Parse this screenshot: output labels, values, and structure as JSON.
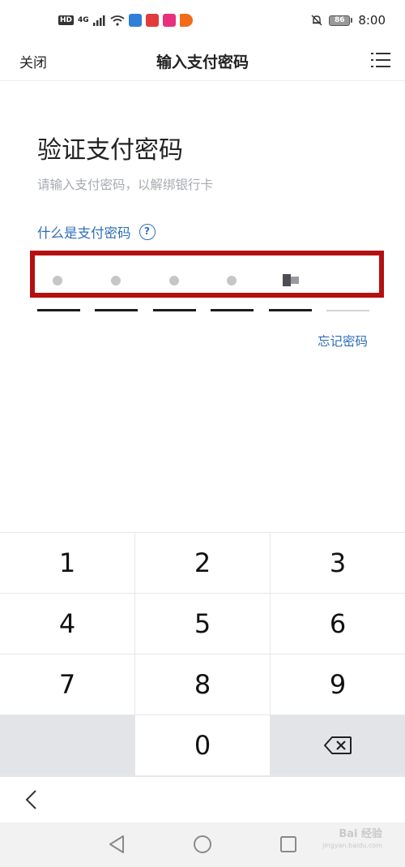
{
  "status_bar": {
    "hd_badge": "HD",
    "network": "4G",
    "battery": "86",
    "time": "8:00",
    "colors": {
      "app1": "#2f7fd6",
      "app2": "#e23b3b",
      "app3": "#e8317e",
      "app4": "#f26a1b"
    }
  },
  "header": {
    "close_label": "关闭",
    "title": "输入支付密码",
    "menu_icon": "menu-list-icon"
  },
  "content": {
    "title": "验证支付密码",
    "subtitle": "请输入支付密码，以解绑银行卡",
    "help_link": "什么是支付密码",
    "help_icon_glyph": "?",
    "forgot_link": "忘记密码"
  },
  "password": {
    "length": 6,
    "entered": 4
  },
  "keypad": {
    "keys": [
      "1",
      "2",
      "3",
      "4",
      "5",
      "6",
      "7",
      "8",
      "9",
      "",
      "0",
      "delete"
    ]
  },
  "navigation": {
    "back_icon": "chevron-left-icon",
    "nav_icons": [
      "nav-back-triangle-icon",
      "nav-home-circle-icon",
      "nav-recents-square-icon"
    ]
  },
  "watermark": {
    "text": "Bai 经验",
    "url": "jingyan.baidu.com"
  },
  "colors": {
    "accent": "#2e6fb8",
    "highlight": "#b50f10",
    "keypad_bg": "#e6e7ea"
  }
}
